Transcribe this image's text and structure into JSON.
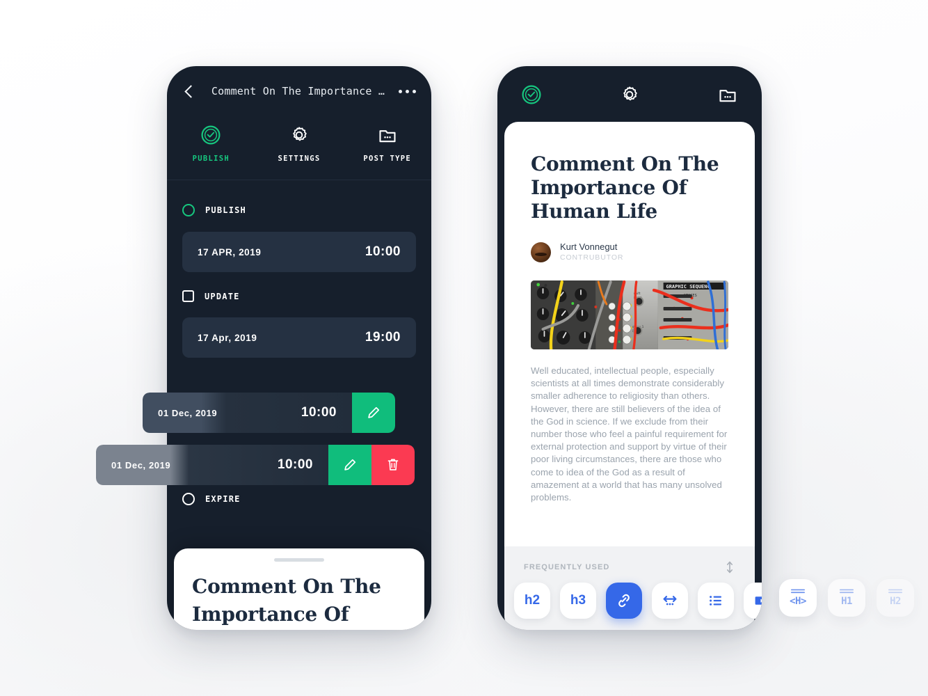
{
  "theme": {
    "accent_green": "#16c77f",
    "action_green": "#10bd7c",
    "action_red": "#fb3a52",
    "accent_blue": "#3568e8",
    "dark_bg": "#161f2c",
    "card_bg": "#253142",
    "page_bg": "#f4f5f7"
  },
  "publish_screen": {
    "nav": {
      "back_icon": "chevron-left-icon",
      "title": "Comment On The Importance …",
      "more_icon": "more-horizontal-icon"
    },
    "tabs": [
      {
        "label": "PUBLISH",
        "icon": "clock-check-circle-icon",
        "active": true
      },
      {
        "label": "SETTINGS",
        "icon": "gear-icon",
        "active": false
      },
      {
        "label": "POST TYPE",
        "icon": "folder-dots-icon",
        "active": false
      }
    ],
    "sections": [
      {
        "control": "radio",
        "state": "selected",
        "label": "PUBLISH",
        "row": {
          "date": "17 APR, 2019",
          "time": "10:00"
        }
      },
      {
        "control": "checkbox",
        "state": "unchecked",
        "label": "UPDATE",
        "row": {
          "date": "17 Apr, 2019",
          "time": "19:00"
        }
      }
    ],
    "swipe_rows": [
      {
        "date": "01 Dec, 2019",
        "time": "10:00",
        "actions": [
          {
            "name": "edit",
            "icon": "pencil-icon",
            "color": "#10bd7c"
          }
        ]
      },
      {
        "date": "01 Dec, 2019",
        "time": "10:00",
        "actions": [
          {
            "name": "edit",
            "icon": "pencil-icon",
            "color": "#10bd7c"
          },
          {
            "name": "delete",
            "icon": "trash-icon",
            "color": "#fb3a52"
          }
        ]
      }
    ],
    "expire": {
      "control": "radio",
      "state": "unselected",
      "label": "EXPIRE"
    },
    "sheet": {
      "title": "Comment On The Importance Of Human Life"
    }
  },
  "editor_screen": {
    "nav": [
      {
        "icon": "clock-check-circle-icon",
        "active": true
      },
      {
        "icon": "gear-icon",
        "active": false
      },
      {
        "icon": "folder-dots-icon",
        "active": false
      }
    ],
    "article": {
      "title": "Comment On The Importance Of Human Life",
      "author": "Kurt Vonnegut",
      "role": "CONTRUBUTOR",
      "image_alt": "modular synthesizer with patch cables",
      "body": "Well educated, intellectual people, especially scientists at all times demonstrate considerably smaller adherence to religiosity than others. However, there are still believers of the idea of the God in science. If we exclude from their number those who feel a painful requirement for external protection and support by virtue of their poor living circumstances, there are those who come to idea of the God as a result of amazement at a world that has many unsolved problems.",
      "gutter_markers": [
        {
          "icon": "key-pin-icon"
        },
        {
          "icon": "key-pin-icon"
        },
        {
          "icon": "key-pin-icon"
        },
        {
          "icon": "key-pin-icon"
        }
      ]
    },
    "toolbar": {
      "label": "FREQUENTLY USED",
      "sort_icon": "sort-vertical-icon",
      "buttons": [
        {
          "name": "heading-2",
          "text": "h2",
          "icon": "",
          "selected": false
        },
        {
          "name": "heading-3",
          "text": "h3",
          "icon": "",
          "selected": false
        },
        {
          "name": "link",
          "text": "",
          "icon": "link-icon",
          "selected": true
        },
        {
          "name": "more-embed",
          "text": "",
          "icon": "arrows-more-icon",
          "selected": false
        },
        {
          "name": "list",
          "text": "",
          "icon": "bullet-list-icon",
          "selected": false
        },
        {
          "name": "video",
          "text": "",
          "icon": "video-icon",
          "selected": false
        }
      ]
    },
    "floating_chips": [
      {
        "name": "heading-code",
        "text": "<H>",
        "opacity": "1.0"
      },
      {
        "name": "heading-1",
        "text": "H1",
        "opacity": "0.62"
      },
      {
        "name": "heading-2",
        "text": "H2",
        "opacity": "0.34"
      }
    ]
  }
}
